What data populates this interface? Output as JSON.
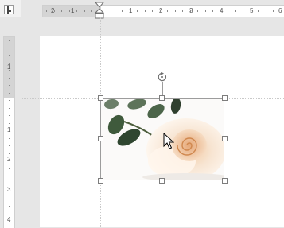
{
  "ruler": {
    "h_numbers": [
      "2",
      "1",
      "1",
      "2",
      "3",
      "4",
      "5",
      "6"
    ],
    "v_numbers": [
      "1",
      "1",
      "2",
      "3",
      "4"
    ]
  },
  "image": {
    "alt": "White rose"
  },
  "icons": {
    "rotate": "rotate-handle-icon",
    "cursor": "mouse-pointer-icon"
  }
}
